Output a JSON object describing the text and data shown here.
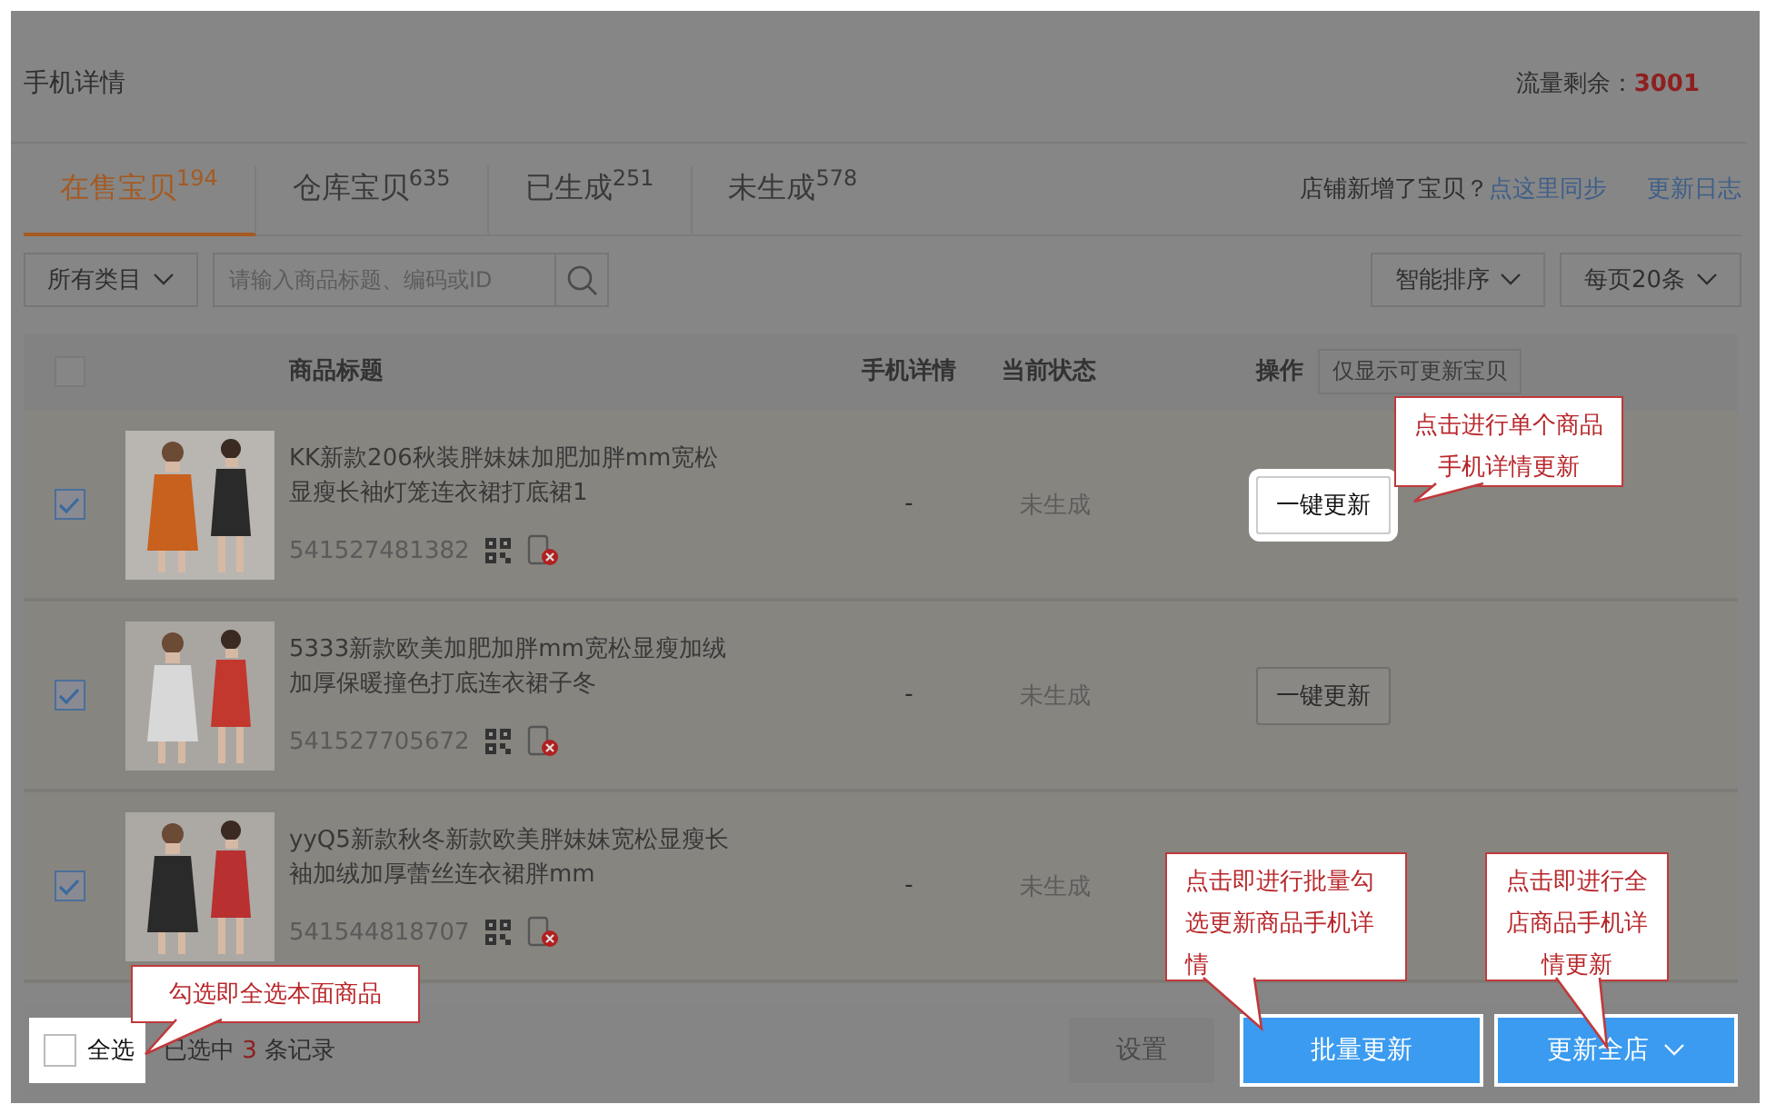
{
  "page_title": "手机详情",
  "traffic": {
    "label": "流量剩余：",
    "value": "3001"
  },
  "tabs": [
    {
      "label": "在售宝贝",
      "count": "194",
      "selected": true
    },
    {
      "label": "仓库宝贝",
      "count": "635",
      "selected": false
    },
    {
      "label": "已生成",
      "count": "251",
      "selected": false
    },
    {
      "label": "未生成",
      "count": "578",
      "selected": false
    }
  ],
  "sync_notice": {
    "text": "店铺新增了宝贝？",
    "link": "点这里同步"
  },
  "changelog_link": "更新日志",
  "filters": {
    "category": "所有类目",
    "search_placeholder": "请输入商品标题、编码或ID",
    "sort": "智能排序",
    "page_size": "每页20条"
  },
  "table": {
    "header_checked": false,
    "columns": [
      "商品标题",
      "手机详情",
      "当前状态",
      "操作"
    ],
    "filter_button": "仅显示可更新宝贝",
    "rows": [
      {
        "checked": true,
        "title": "KK新款206秋装胖妹妹加肥加胖mm宽松显瘦长袖灯笼连衣裙打底裙1",
        "id": "541527481382",
        "mobile_detail": "-",
        "status": "未生成",
        "action": {
          "label": "一键更新",
          "highlighted": true
        }
      },
      {
        "checked": true,
        "title": "5333新款欧美加肥加胖mm宽松显瘦加绒加厚保暖撞色打底连衣裙子冬",
        "id": "541527705672",
        "mobile_detail": "-",
        "status": "未生成",
        "action": {
          "label": "一键更新",
          "highlighted": false
        }
      },
      {
        "checked": true,
        "title": "yyQ5新款秋冬新款欧美胖妹妹宽松显瘦长袖加绒加厚蕾丝连衣裙胖mm",
        "id": "541544818707",
        "mobile_detail": "-",
        "status": "未生成"
      }
    ]
  },
  "footer": {
    "select_all": {
      "label": "全选",
      "checked": false,
      "highlighted": true
    },
    "selected_prefix": "已选中",
    "selected_count": "3",
    "selected_suffix": "条记录",
    "buttons": [
      {
        "label": "设置",
        "kind": "plain",
        "highlighted": false
      },
      {
        "label": "批量更新",
        "kind": "primary",
        "highlighted": true
      },
      {
        "label": "更新全店",
        "kind": "primary",
        "highlighted": true,
        "dropdown": true
      }
    ]
  },
  "callouts": [
    {
      "text": "点击进行单个商品手机详情更新"
    },
    {
      "text": "点击即进行批量勾选更新商品手机详情"
    },
    {
      "text": "点击即进行全店商品手机详情更新"
    },
    {
      "text": "勾选即全选本面商品"
    }
  ]
}
